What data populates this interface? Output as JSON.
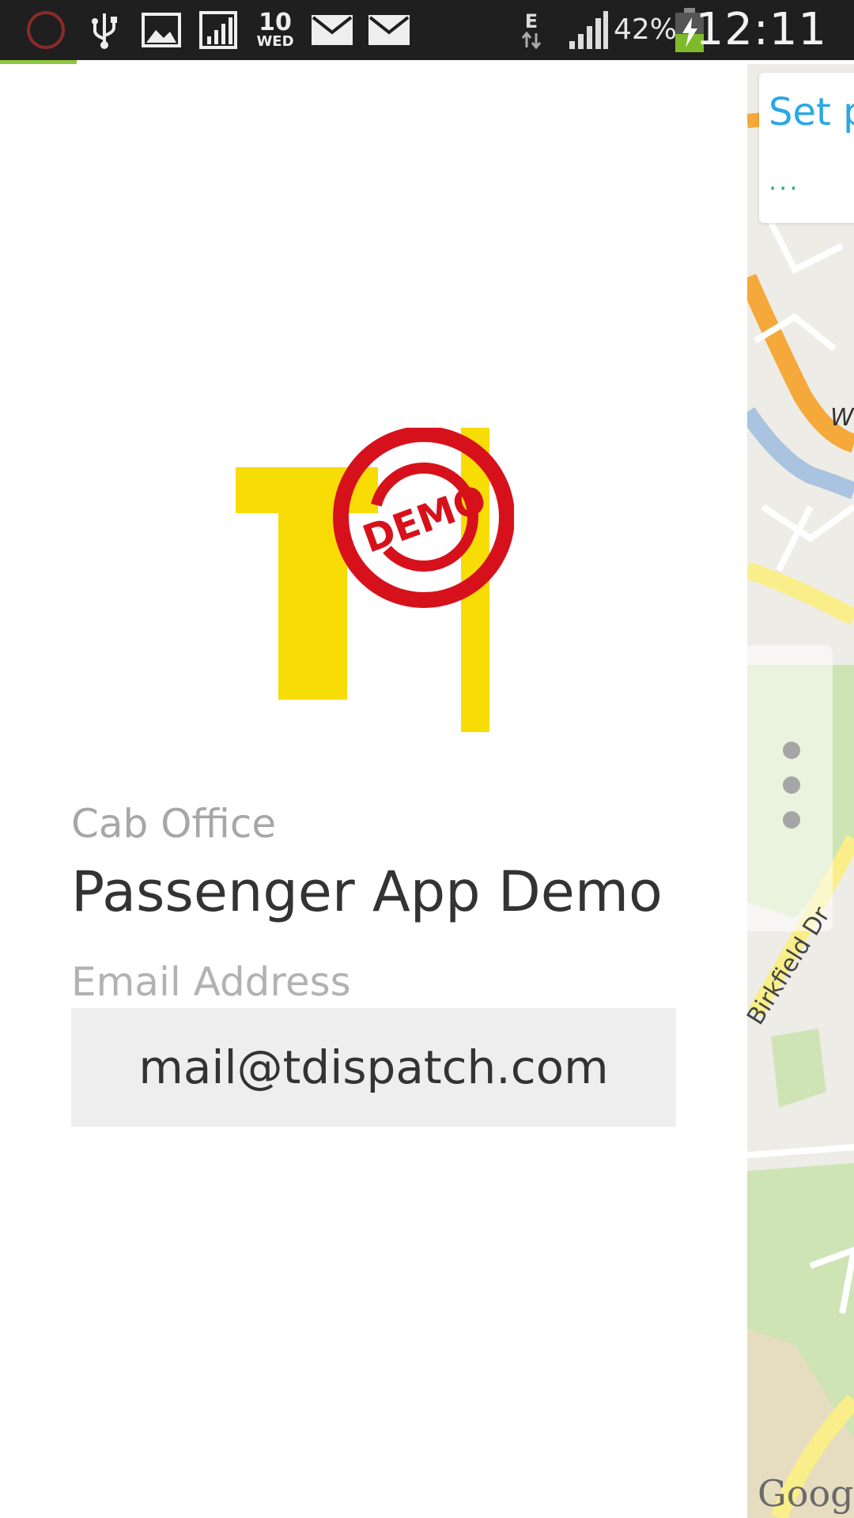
{
  "status_bar": {
    "time": "12:11",
    "battery_percent": "42%",
    "calendar_day": "10",
    "calendar_weekday": "WED",
    "network_type": "E",
    "icons": [
      "circle-notification-icon",
      "usb-icon",
      "image-icon",
      "signal-bars-app-icon",
      "calendar-icon",
      "mail-icon",
      "mail-icon",
      "edge-data-icon",
      "signal-strength-icon",
      "battery-charging-icon"
    ],
    "loading_progress": 0.09
  },
  "drawer": {
    "logo_text": "DEMO",
    "office_label": "Cab Office",
    "company_name": "Passenger App Demo",
    "email_label": "Email Address",
    "email_value": "mail@tdispatch.com"
  },
  "map": {
    "card_title": "Set p",
    "card_subtitle": "...",
    "street_label": "Birkfield Dr",
    "road_label": "W",
    "attribution": "Google"
  },
  "colors": {
    "accent_green": "#8dc63f",
    "logo_yellow": "#f8dc06",
    "stamp_red": "#d7111b",
    "link_blue": "#2aa7e4"
  }
}
